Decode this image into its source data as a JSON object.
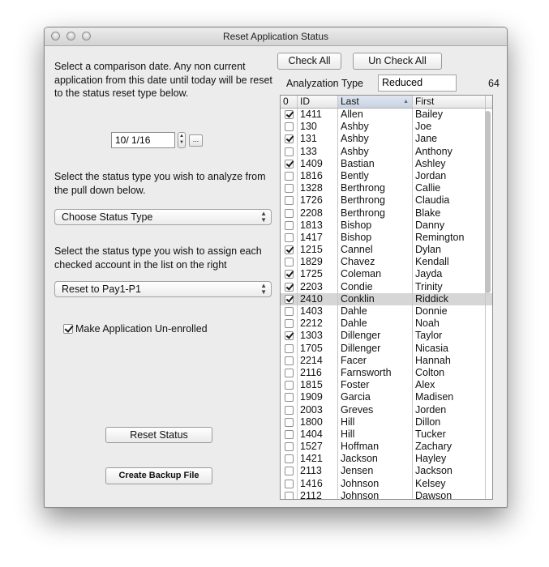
{
  "window": {
    "title": "Reset Application Status"
  },
  "toolbar": {
    "check_all": "Check All",
    "uncheck_all": "Un Check All"
  },
  "left": {
    "instruction1": "Select a comparison date. Any non current application from this date until today will be reset to the status reset type below.",
    "date_value": "10/ 1/16",
    "cal_button": "...",
    "instruction2": "Select the status type you wish to analyze from the pull down below.",
    "status_type_select": "Choose Status Type",
    "instruction3": "Select the status type you wish to assign each checked account in the list on the right",
    "assign_select": "Reset to Pay1-P1",
    "unenroll_label": "Make Application Un-enrolled",
    "unenroll_checked": true,
    "reset_button": "Reset Status",
    "backup_button": "Create Backup File"
  },
  "analyzation": {
    "label": "Analyzation Type",
    "value": "Reduced",
    "count": "64"
  },
  "table": {
    "headers": {
      "check": "0",
      "id": "ID",
      "last": "Last",
      "first": "First"
    },
    "selected_row": 15,
    "rows": [
      {
        "checked": true,
        "id": "1411",
        "last": "Allen",
        "first": "Bailey"
      },
      {
        "checked": false,
        "id": "130",
        "last": "Ashby",
        "first": "Joe"
      },
      {
        "checked": true,
        "id": "131",
        "last": "Ashby",
        "first": "Jane"
      },
      {
        "checked": false,
        "id": "133",
        "last": "Ashby",
        "first": "Anthony"
      },
      {
        "checked": true,
        "id": "1409",
        "last": "Bastian",
        "first": "Ashley"
      },
      {
        "checked": false,
        "id": "1816",
        "last": "Bently",
        "first": "Jordan"
      },
      {
        "checked": false,
        "id": "1328",
        "last": "Berthrong",
        "first": "Callie"
      },
      {
        "checked": false,
        "id": "1726",
        "last": "Berthrong",
        "first": "Claudia"
      },
      {
        "checked": false,
        "id": "2208",
        "last": "Berthrong",
        "first": "Blake"
      },
      {
        "checked": false,
        "id": "1813",
        "last": "Bishop",
        "first": "Danny"
      },
      {
        "checked": false,
        "id": "1417",
        "last": "Bishop",
        "first": "Remington"
      },
      {
        "checked": true,
        "id": "1215",
        "last": "Cannel",
        "first": "Dylan"
      },
      {
        "checked": false,
        "id": "1829",
        "last": "Chavez",
        "first": "Kendall"
      },
      {
        "checked": true,
        "id": "1725",
        "last": "Coleman",
        "first": "Jayda"
      },
      {
        "checked": true,
        "id": "2203",
        "last": "Condie",
        "first": "Trinity"
      },
      {
        "checked": true,
        "id": "2410",
        "last": "Conklin",
        "first": "Riddick"
      },
      {
        "checked": false,
        "id": "1403",
        "last": "Dahle",
        "first": "Donnie"
      },
      {
        "checked": false,
        "id": "2212",
        "last": "Dahle",
        "first": "Noah"
      },
      {
        "checked": true,
        "id": "1303",
        "last": "Dillenger",
        "first": "Taylor"
      },
      {
        "checked": false,
        "id": "1705",
        "last": "Dillenger",
        "first": "Nicasia"
      },
      {
        "checked": false,
        "id": "2214",
        "last": "Facer",
        "first": "Hannah"
      },
      {
        "checked": false,
        "id": "2116",
        "last": "Farnsworth",
        "first": "Colton"
      },
      {
        "checked": false,
        "id": "1815",
        "last": "Foster",
        "first": "Alex"
      },
      {
        "checked": false,
        "id": "1909",
        "last": "Garcia",
        "first": "Madisen"
      },
      {
        "checked": false,
        "id": "2003",
        "last": "Greves",
        "first": "Jorden"
      },
      {
        "checked": false,
        "id": "1800",
        "last": "Hill",
        "first": "Dillon"
      },
      {
        "checked": false,
        "id": "1404",
        "last": "Hill",
        "first": "Tucker"
      },
      {
        "checked": false,
        "id": "1527",
        "last": "Hoffman",
        "first": "Zachary"
      },
      {
        "checked": false,
        "id": "1421",
        "last": "Jackson",
        "first": "Hayley"
      },
      {
        "checked": false,
        "id": "2113",
        "last": "Jensen",
        "first": "Jackson"
      },
      {
        "checked": false,
        "id": "1416",
        "last": "Johnson",
        "first": "Kelsey"
      },
      {
        "checked": false,
        "id": "2112",
        "last": "Johnson",
        "first": "Dawson"
      }
    ]
  }
}
